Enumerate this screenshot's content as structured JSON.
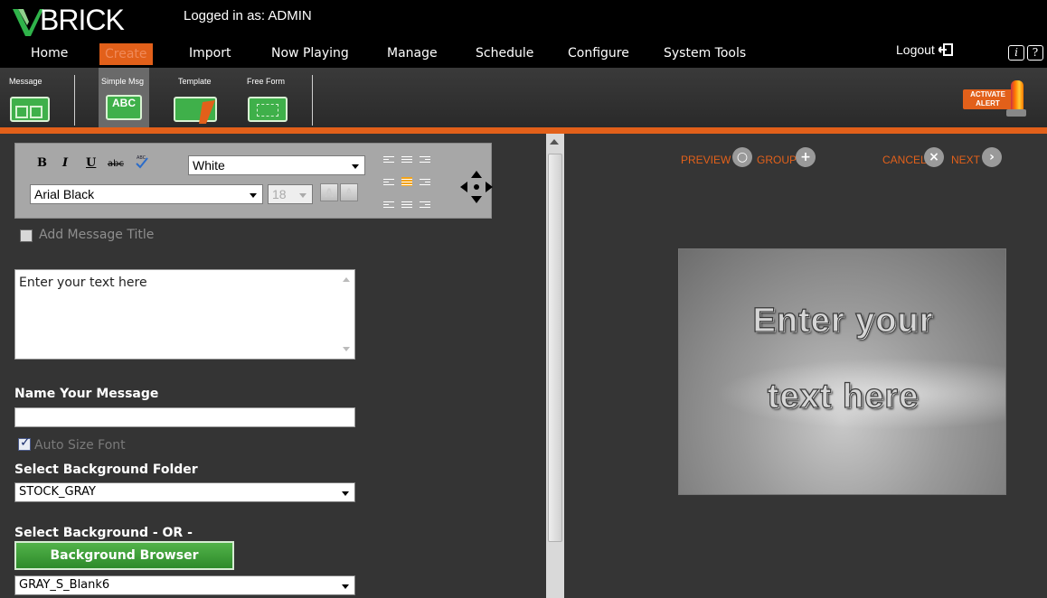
{
  "header": {
    "brand": "BRICK",
    "logged_in": "Logged in as: ADMIN",
    "logout": "Logout",
    "info_icon": "i",
    "help_icon": "?"
  },
  "nav": {
    "items": [
      "Home",
      "Create",
      "Import",
      "Now Playing",
      "Manage",
      "Schedule",
      "Configure",
      "System Tools"
    ],
    "active": "Create"
  },
  "toolbar": {
    "tools": [
      "Message",
      "Simple Msg",
      "Template",
      "Free Form"
    ],
    "selected": "Simple Msg",
    "simple_icon_text": "ABC",
    "activate_line1": "ACTIVATE",
    "activate_line2": "ALERT"
  },
  "format": {
    "bold": "B",
    "italic": "I",
    "underline": "U",
    "strike": "abc",
    "color_value": "White",
    "font_value": "Arial Black",
    "size_value": "18"
  },
  "form": {
    "add_title_label": "Add Message Title",
    "message_text": "Enter your text here",
    "name_label": "Name Your Message",
    "name_value": "",
    "autosize_label": "Auto Size Font",
    "bg_folder_label": "Select Background Folder",
    "bg_folder_value": "STOCK_GRAY",
    "bg_select_label": "Select Background - OR -",
    "bg_browser_button": "Background Browser",
    "bg_value": "GRAY_S_Blank6"
  },
  "actions": {
    "preview": "PREVIEW",
    "group": "GROUP",
    "cancel": "CANCEL",
    "next": "NEXT"
  },
  "preview": {
    "line1": "Enter your",
    "line2": "text here"
  },
  "colors": {
    "accent": "#e2601a",
    "green": "#3fb04a"
  }
}
